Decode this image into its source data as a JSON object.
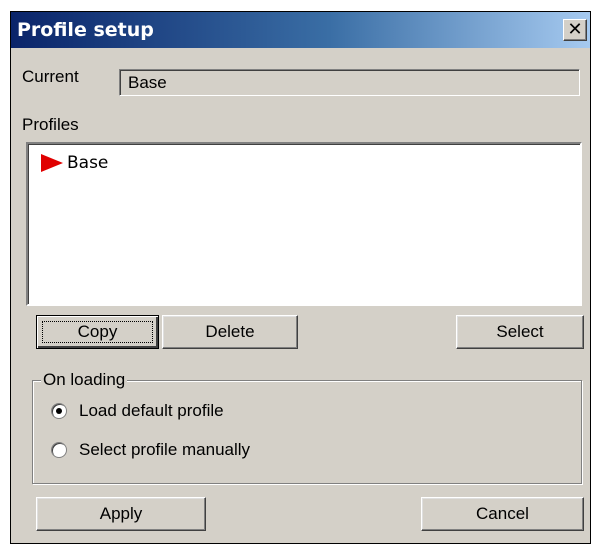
{
  "window": {
    "title": "Profile setup",
    "close_glyph": "✕"
  },
  "current": {
    "label": "Current",
    "value": "Base"
  },
  "profiles": {
    "label": "Profiles",
    "items": [
      {
        "label": "Base",
        "icon": "red-flag-icon",
        "icon_color": "#e00000"
      }
    ]
  },
  "buttons": {
    "copy": "Copy",
    "delete": "Delete",
    "select": "Select",
    "apply": "Apply",
    "cancel": "Cancel"
  },
  "on_loading": {
    "title": "On loading",
    "options": [
      {
        "label": "Load default profile",
        "selected": true
      },
      {
        "label": "Select profile manually",
        "selected": false
      }
    ]
  },
  "colors": {
    "titlebar_start": "#0a246a",
    "titlebar_end": "#a6caf0",
    "face": "#d4d0c8"
  }
}
